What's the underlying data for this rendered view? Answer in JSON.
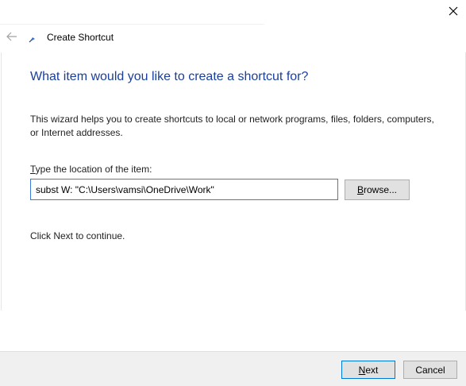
{
  "window": {
    "close_icon": "close-icon"
  },
  "header": {
    "back_icon": "back-arrow-icon",
    "app_icon": "shortcut-wizard-icon",
    "title": "Create Shortcut"
  },
  "main": {
    "heading": "What item would you like to create a shortcut for?",
    "description": "This wizard helps you to create shortcuts to local or network programs, files, folders, computers, or Internet addresses.",
    "location_label_first": "T",
    "location_label_rest": "ype the location of the item:",
    "location_value": "subst W: \"C:\\Users\\vamsi\\OneDrive\\Work\"",
    "browse_first": "B",
    "browse_rest": "rowse...",
    "continue_text": "Click Next to continue."
  },
  "footer": {
    "next_first": "N",
    "next_rest": "ext",
    "cancel_label": "Cancel"
  },
  "colors": {
    "heading": "#1a3f9a",
    "input_border": "#3a7bd5",
    "footer_bg": "#f0f0f0",
    "default_button_border": "#0078d7"
  }
}
